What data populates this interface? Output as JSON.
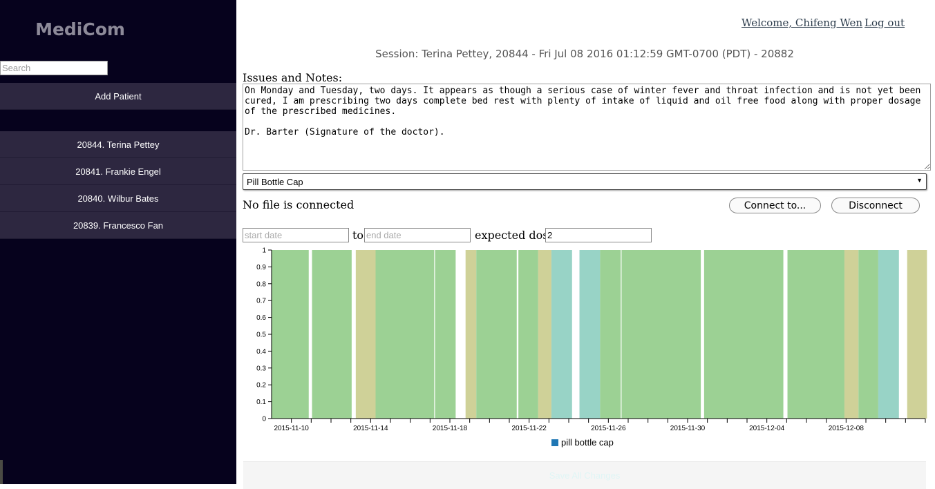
{
  "app": {
    "title": "MediCom"
  },
  "sidebar": {
    "search_placeholder": "Search",
    "add_patient": "Add Patient",
    "patients": [
      "20844. Terina Pettey",
      "20841. Frankie Engel",
      "20840. Wilbur Bates",
      "20839. Francesco Fan"
    ]
  },
  "header": {
    "welcome": "Welcome, Chifeng Wen",
    "logout": "Log out"
  },
  "session": "Session: Terina Pettey, 20844 - Fri Jul 08 2016 01:12:59 GMT-0700 (PDT) - 20882",
  "notes": {
    "label": "Issues and Notes:",
    "text": "On Monday and Tuesday, two days. It appears as though a serious case of winter fever and throat infection and is not yet been cured, I am prescribing two days complete bed rest with plenty of intake of liquid and oil free food along with proper dosage of the prescribed medicines.\n\nDr. Barter (Signature of the doctor)."
  },
  "device": {
    "selected": "Pill Bottle Cap",
    "arrow_icon": "triangle-down-icon"
  },
  "connection": {
    "status": "No file is connected",
    "connect": "Connect to...",
    "disconnect": "Disconnect"
  },
  "filters": {
    "start_placeholder": "start date",
    "to": "to",
    "end_placeholder": "end date",
    "dose_label": "expected dose",
    "dose_value": "2"
  },
  "chart_data": {
    "type": "bar",
    "ylim": [
      0,
      1
    ],
    "y_ticks": [
      "0",
      "0.1",
      "0.2",
      "0.3",
      "0.4",
      "0.5",
      "0.6",
      "0.7",
      "0.8",
      "0.9",
      "1"
    ],
    "x_tick_labels": [
      "2015-11-10",
      "2015-11-14",
      "2015-11-18",
      "2015-11-22",
      "2015-11-26",
      "2015-11-30",
      "2015-12-04",
      "2015-12-08"
    ],
    "x_start": "2015-11-09",
    "x_end": "2015-12-12",
    "colors": {
      "green": "#9cd194",
      "olive": "#cfd198",
      "teal": "#98d3c6"
    },
    "bars": [
      {
        "from": "2015-11-09 00:00",
        "to": "2015-11-10 21:00",
        "value": 1,
        "color": "green"
      },
      {
        "from": "2015-11-11 01:00",
        "to": "2015-11-13 01:00",
        "value": 1,
        "color": "green"
      },
      {
        "from": "2015-11-13 06:00",
        "to": "2015-11-14 06:00",
        "value": 1,
        "color": "olive"
      },
      {
        "from": "2015-11-14 06:00",
        "to": "2015-11-17 05:00",
        "value": 1,
        "color": "green"
      },
      {
        "from": "2015-11-17 06:00",
        "to": "2015-11-18 07:00",
        "value": 1,
        "color": "green"
      },
      {
        "from": "2015-11-18 19:00",
        "to": "2015-11-19 08:00",
        "value": 1,
        "color": "olive"
      },
      {
        "from": "2015-11-19 08:00",
        "to": "2015-11-21 09:00",
        "value": 1,
        "color": "green"
      },
      {
        "from": "2015-11-21 11:00",
        "to": "2015-11-22 11:00",
        "value": 1,
        "color": "green"
      },
      {
        "from": "2015-11-22 11:00",
        "to": "2015-11-23 03:00",
        "value": 1,
        "color": "olive"
      },
      {
        "from": "2015-11-23 03:00",
        "to": "2015-11-24 04:00",
        "value": 1,
        "color": "teal"
      },
      {
        "from": "2015-11-24 13:00",
        "to": "2015-11-25 14:00",
        "value": 1,
        "color": "teal"
      },
      {
        "from": "2015-11-25 14:00",
        "to": "2015-11-26 15:00",
        "value": 1,
        "color": "green"
      },
      {
        "from": "2015-11-26 16:00",
        "to": "2015-11-30 16:00",
        "value": 1,
        "color": "green"
      },
      {
        "from": "2015-11-30 20:00",
        "to": "2015-12-04 20:00",
        "value": 1,
        "color": "green"
      },
      {
        "from": "2015-12-05 01:00",
        "to": "2015-12-07 22:00",
        "value": 1,
        "color": "green"
      },
      {
        "from": "2015-12-07 22:00",
        "to": "2015-12-08 15:00",
        "value": 1,
        "color": "olive"
      },
      {
        "from": "2015-12-08 15:00",
        "to": "2015-12-09 15:00",
        "value": 1,
        "color": "green"
      },
      {
        "from": "2015-12-09 15:00",
        "to": "2015-12-10 16:00",
        "value": 1,
        "color": "teal"
      },
      {
        "from": "2015-12-11 02:00",
        "to": "2015-12-12 02:00",
        "value": 1,
        "color": "olive"
      }
    ],
    "legend": [
      {
        "name": "pill bottle cap",
        "color": "#1f77b4"
      }
    ]
  },
  "save": {
    "label": "Save All Changes"
  }
}
